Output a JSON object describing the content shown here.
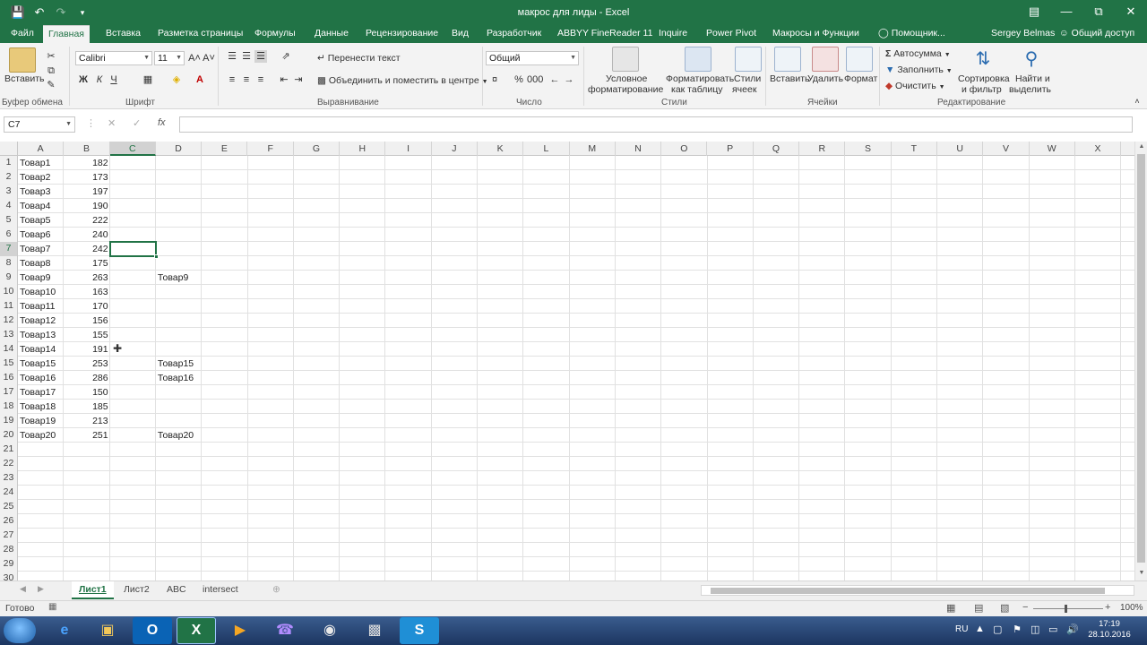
{
  "titlebar": {
    "title": "макрос для лиды - Excel",
    "qat_icons": [
      "save-icon",
      "undo-icon",
      "redo-icon",
      "customize-qat-icon"
    ],
    "window_icons": [
      "ribbon-display-icon",
      "minimize-icon",
      "restore-icon",
      "close-icon"
    ]
  },
  "tabs": {
    "items": [
      "Файл",
      "Главная",
      "Вставка",
      "Разметка страницы",
      "Формулы",
      "Данные",
      "Рецензирование",
      "Вид",
      "Разработчик",
      "ABBYY FineReader 11",
      "Inquire",
      "Power Pivot",
      "Макросы и Функции",
      "Помощник..."
    ],
    "active": "Главная",
    "user": "Sergey Belmas",
    "share": "Общий доступ"
  },
  "ribbon": {
    "clipboard": {
      "paste": "Вставить",
      "label": "Буфер обмена"
    },
    "font": {
      "name": "Calibri",
      "size": "11",
      "bold": "Ж",
      "italic": "К",
      "underline": "Ч",
      "label": "Шрифт"
    },
    "alignment": {
      "wrap": "Перенести текст",
      "merge": "Объединить и поместить в центре",
      "label": "Выравнивание"
    },
    "number": {
      "format": "Общий",
      "label": "Число"
    },
    "styles": {
      "conditional_1": "Условное",
      "conditional_2": "форматирование",
      "table_1": "Форматировать",
      "table_2": "как таблицу",
      "cell_1": "Стили",
      "cell_2": "ячеек",
      "label": "Стили"
    },
    "cells": {
      "insert": "Вставить",
      "delete": "Удалить",
      "format": "Формат",
      "label": "Ячейки"
    },
    "editing": {
      "autosum": "Автосумма",
      "fill": "Заполнить",
      "clear": "Очистить",
      "sort_1": "Сортировка",
      "sort_2": "и фильтр",
      "find_1": "Найти и",
      "find_2": "выделить",
      "label": "Редактирование"
    }
  },
  "formula_bar": {
    "name_box": "C7",
    "cancel": "✕",
    "enter": "✓",
    "fx": "fx",
    "value": ""
  },
  "grid": {
    "columns": [
      "A",
      "B",
      "C",
      "D",
      "E",
      "F",
      "G",
      "H",
      "I",
      "J",
      "K",
      "L",
      "M",
      "N",
      "O",
      "P",
      "Q",
      "R",
      "S",
      "T",
      "U",
      "V",
      "W",
      "X"
    ],
    "selected_column": "C",
    "selected_row": 7,
    "rows": [
      {
        "n": "1",
        "a": "Товар1",
        "b": "182",
        "d": ""
      },
      {
        "n": "2",
        "a": "Товар2",
        "b": "173",
        "d": ""
      },
      {
        "n": "3",
        "a": "Товар3",
        "b": "197",
        "d": ""
      },
      {
        "n": "4",
        "a": "Товар4",
        "b": "190",
        "d": ""
      },
      {
        "n": "5",
        "a": "Товар5",
        "b": "222",
        "d": ""
      },
      {
        "n": "6",
        "a": "Товар6",
        "b": "240",
        "d": ""
      },
      {
        "n": "7",
        "a": "Товар7",
        "b": "242",
        "d": ""
      },
      {
        "n": "8",
        "a": "Товар8",
        "b": "175",
        "d": ""
      },
      {
        "n": "9",
        "a": "Товар9",
        "b": "263",
        "d": "Товар9"
      },
      {
        "n": "10",
        "a": "Товар10",
        "b": "163",
        "d": ""
      },
      {
        "n": "11",
        "a": "Товар11",
        "b": "170",
        "d": ""
      },
      {
        "n": "12",
        "a": "Товар12",
        "b": "156",
        "d": ""
      },
      {
        "n": "13",
        "a": "Товар13",
        "b": "155",
        "d": ""
      },
      {
        "n": "14",
        "a": "Товар14",
        "b": "191",
        "d": ""
      },
      {
        "n": "15",
        "a": "Товар15",
        "b": "253",
        "d": "Товар15"
      },
      {
        "n": "16",
        "a": "Товар16",
        "b": "286",
        "d": "Товар16"
      },
      {
        "n": "17",
        "a": "Товар17",
        "b": "150",
        "d": ""
      },
      {
        "n": "18",
        "a": "Товар18",
        "b": "185",
        "d": ""
      },
      {
        "n": "19",
        "a": "Товар19",
        "b": "213",
        "d": ""
      },
      {
        "n": "20",
        "a": "Товар20",
        "b": "251",
        "d": "Товар20"
      },
      {
        "n": "21",
        "a": "",
        "b": "",
        "d": ""
      },
      {
        "n": "22",
        "a": "",
        "b": "",
        "d": ""
      },
      {
        "n": "23",
        "a": "",
        "b": "",
        "d": ""
      },
      {
        "n": "24",
        "a": "",
        "b": "",
        "d": ""
      },
      {
        "n": "25",
        "a": "",
        "b": "",
        "d": ""
      },
      {
        "n": "26",
        "a": "",
        "b": "",
        "d": ""
      },
      {
        "n": "27",
        "a": "",
        "b": "",
        "d": ""
      },
      {
        "n": "28",
        "a": "",
        "b": "",
        "d": ""
      },
      {
        "n": "29",
        "a": "",
        "b": "",
        "d": ""
      },
      {
        "n": "30",
        "a": "",
        "b": "",
        "d": ""
      }
    ]
  },
  "sheets": {
    "items": [
      "Лист1",
      "Лист2",
      "ABC",
      "intersect"
    ],
    "active": "Лист1",
    "add": "⊕"
  },
  "status": {
    "text": "Готово",
    "zoom": "100%",
    "zoom_minus": "−",
    "zoom_plus": "+"
  },
  "taskbar": {
    "lang": "RU",
    "time": "17:19",
    "date": "28.10.2016"
  },
  "colors": {
    "accent": "#217346"
  }
}
